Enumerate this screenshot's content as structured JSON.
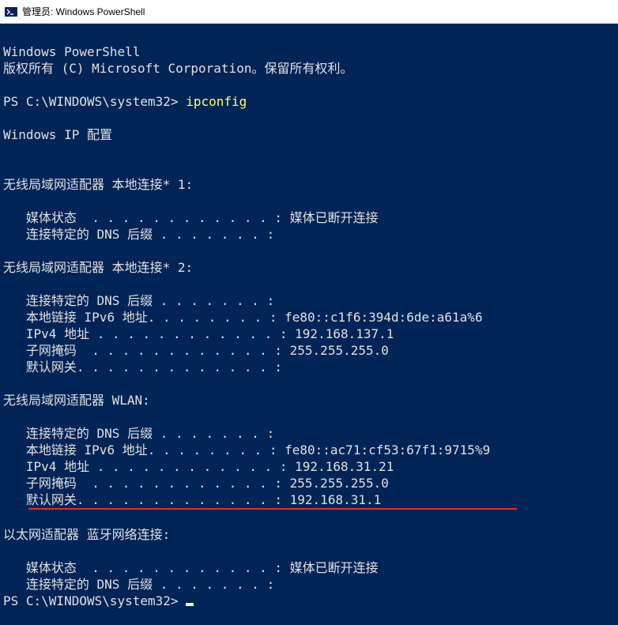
{
  "titlebar": {
    "title": "管理员: Windows PowerShell"
  },
  "banner": {
    "line1": "Windows PowerShell",
    "line2": "版权所有 (C) Microsoft Corporation。保留所有权利。"
  },
  "prompt1": {
    "path": "PS C:\\WINDOWS\\system32>",
    "command": "ipconfig"
  },
  "ipconfig_header": "Windows IP 配置",
  "adapters": [
    {
      "title": "无线局域网适配器 本地连接* 1:",
      "rows": [
        {
          "label": "媒体状态",
          "dots": "  . . . . . . . . . . . . :",
          "value": " 媒体已断开连接"
        },
        {
          "label": "连接特定的 DNS 后缀",
          "dots": " . . . . . . . :",
          "value": ""
        }
      ]
    },
    {
      "title": "无线局域网适配器 本地连接* 2:",
      "rows": [
        {
          "label": "连接特定的 DNS 后缀",
          "dots": " . . . . . . . :",
          "value": ""
        },
        {
          "label": "本地链接 IPv6 地址",
          "dots": ". . . . . . . . :",
          "value": " fe80::c1f6:394d:6de:a61a%6"
        },
        {
          "label": "IPv4 地址",
          "dots": " . . . . . . . . . . . . :",
          "value": " 192.168.137.1"
        },
        {
          "label": "子网掩码",
          "dots": "  . . . . . . . . . . . . :",
          "value": " 255.255.255.0"
        },
        {
          "label": "默认网关",
          "dots": ". . . . . . . . . . . . . :",
          "value": ""
        }
      ]
    },
    {
      "title": "无线局域网适配器 WLAN:",
      "rows": [
        {
          "label": "连接特定的 DNS 后缀",
          "dots": " . . . . . . . :",
          "value": ""
        },
        {
          "label": "本地链接 IPv6 地址",
          "dots": ". . . . . . . . :",
          "value": " fe80::ac71:cf53:67f1:9715%9"
        },
        {
          "label": "IPv4 地址",
          "dots": " . . . . . . . . . . . . :",
          "value": " 192.168.31.21"
        },
        {
          "label": "子网掩码",
          "dots": "  . . . . . . . . . . . . :",
          "value": " 255.255.255.0"
        },
        {
          "label": "默认网关",
          "dots": ". . . . . . . . . . . . . :",
          "value": " 192.168.31.1"
        }
      ],
      "underline_after": true
    },
    {
      "title": "以太网适配器 蓝牙网络连接:",
      "rows": [
        {
          "label": "媒体状态",
          "dots": "  . . . . . . . . . . . . :",
          "value": " 媒体已断开连接"
        },
        {
          "label": "连接特定的 DNS 后缀",
          "dots": " . . . . . . . :",
          "value": ""
        }
      ]
    }
  ],
  "prompt2": {
    "path": "PS C:\\WINDOWS\\system32>"
  }
}
